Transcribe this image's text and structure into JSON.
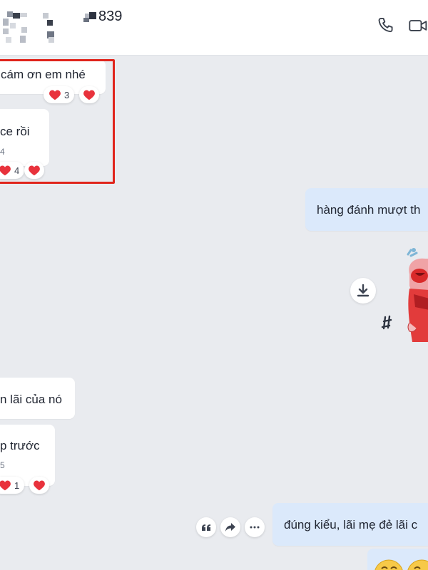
{
  "header": {
    "title_suffix": "839",
    "call_icon": "phone-icon",
    "video_icon": "video-camera-icon"
  },
  "messages": {
    "m1": {
      "text": "cám ơn em nhé",
      "reaction_count": "3"
    },
    "m2": {
      "text": "ce rồi",
      "meta": "4",
      "reaction_count": "4"
    },
    "m3": {
      "text": "hàng đánh mượt th"
    },
    "m4": {
      "text": "n lãi của nó"
    },
    "m5": {
      "text": "p trước",
      "meta": "5",
      "reaction_count": "1"
    },
    "m6": {
      "text": "đúng kiểu, lãi mẹ đẻ lãi c"
    }
  },
  "icons": {
    "heart": "heart-icon",
    "download": "download-icon",
    "quote": "quote-icon",
    "share": "share-icon",
    "more": "more-icon"
  },
  "colors": {
    "background": "#e9ebef",
    "my_bubble": "#dbe9fb",
    "highlight": "#e0241b",
    "heart": "#e8323c"
  }
}
